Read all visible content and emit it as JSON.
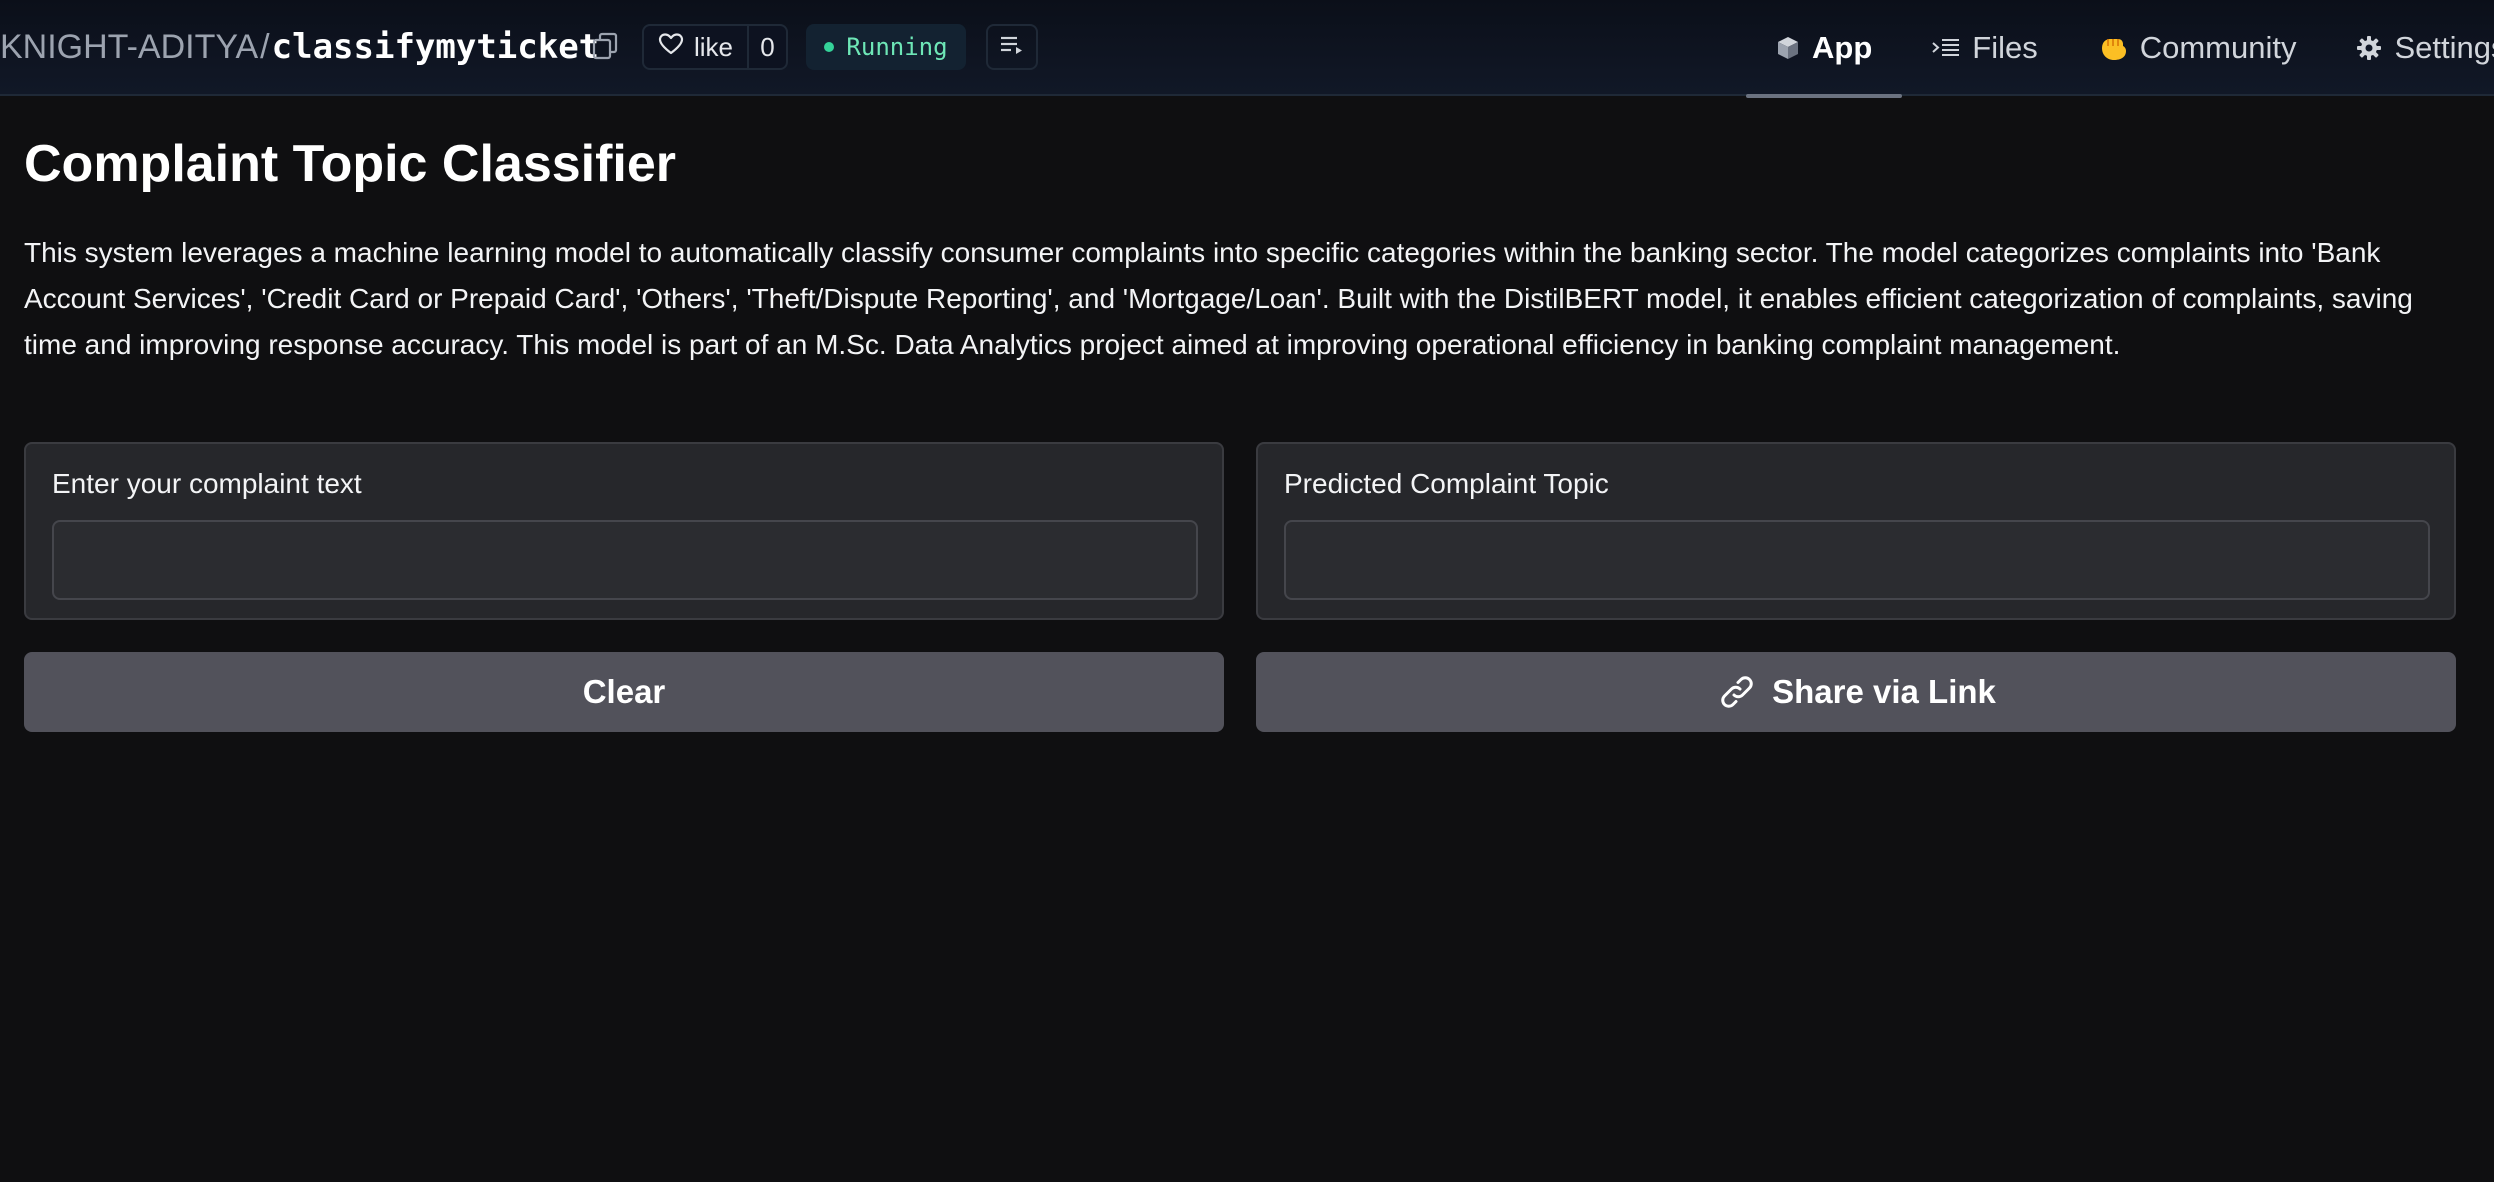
{
  "header": {
    "owner": "KNIGHT-ADITYA",
    "separator": "/",
    "repo_name": "classifymyticket",
    "like_label": "like",
    "like_count": "0",
    "status": "Running",
    "status_color": "#34d399",
    "icons": {
      "copy": "copy-icon",
      "like": "heart-icon",
      "logs": "logs-icon"
    }
  },
  "nav": {
    "tabs": [
      {
        "label": "App",
        "icon": "cube-icon",
        "active": true
      },
      {
        "label": "Files",
        "icon": "files-icon",
        "active": false
      },
      {
        "label": "Community",
        "icon": "hand-icon",
        "active": false
      },
      {
        "label": "Settings",
        "icon": "gear-icon",
        "active": false
      }
    ]
  },
  "main": {
    "title": "Complaint Topic Classifier",
    "description": "This system leverages a machine learning model to automatically classify consumer complaints into specific categories within the banking sector. The model categorizes complaints into 'Bank Account Services', 'Credit Card or Prepaid Card', 'Others', 'Theft/Dispute Reporting', and 'Mortgage/Loan'. Built with the DistilBERT model, it enables efficient categorization of complaints, saving time and improving response accuracy. This model is part of an M.Sc. Data Analytics project aimed at improving operational efficiency in banking complaint management.",
    "input_panel": {
      "label": "Enter your complaint text",
      "value": "",
      "placeholder": ""
    },
    "output_panel": {
      "label": "Predicted Complaint Topic",
      "value": "",
      "placeholder": ""
    },
    "buttons": {
      "clear": "Clear",
      "share": "Share via Link",
      "share_icon": "link-icon"
    }
  },
  "colors": {
    "background": "#0f0f11",
    "panel": "#26272b",
    "button": "#52525b",
    "status_text": "#6ee7b7"
  }
}
